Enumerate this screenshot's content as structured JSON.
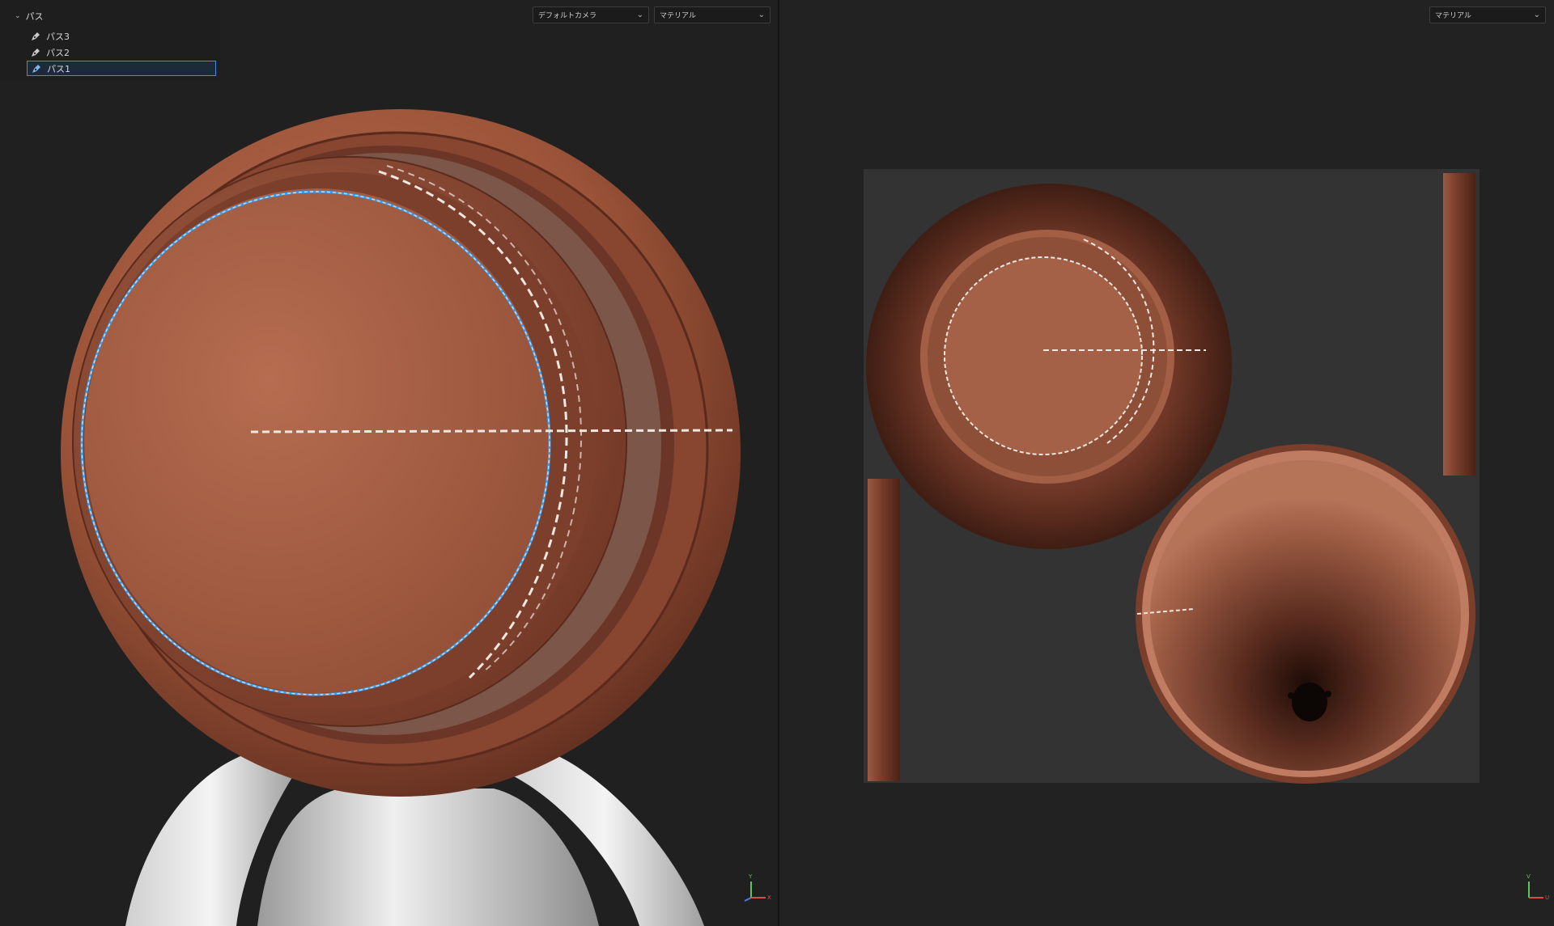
{
  "outliner": {
    "header_label": "パス",
    "items": [
      {
        "label": "パス3"
      },
      {
        "label": "パス2"
      },
      {
        "label": "パス1",
        "selected": true
      }
    ]
  },
  "viewport_3d": {
    "camera_select": "デフォルトカメラ",
    "shading_select": "マテリアル",
    "gizmo": {
      "y": "Y",
      "x": "X"
    }
  },
  "viewport_uv": {
    "shading_select": "マテリアル",
    "gizmo": {
      "v": "V",
      "u": "U"
    }
  },
  "colors": {
    "leather": "#a55e45",
    "leather_dark": "#6a3424",
    "stitch": "#f0e8e0",
    "selection_path": "#3d9be9",
    "uv_bg": "#333333",
    "body_white": "#e8e8e8"
  }
}
